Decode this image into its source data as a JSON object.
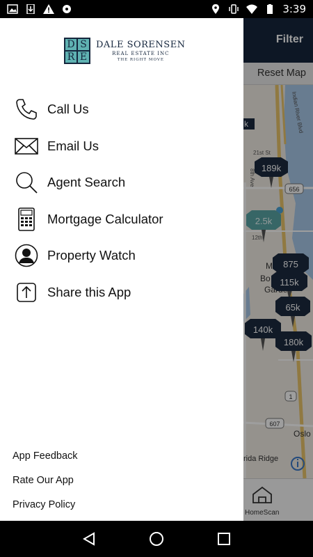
{
  "status_bar": {
    "time": "3:39",
    "left_icons": [
      "image-icon",
      "download-icon",
      "warning-icon",
      "location-sync-icon"
    ],
    "right_icons": [
      "location-icon",
      "vibrate-icon",
      "wifi-icon",
      "battery-icon"
    ]
  },
  "app": {
    "filter_label": "Filter",
    "reset_map_label": "Reset Map",
    "homescan_label": "HomeScan"
  },
  "map": {
    "street_labels": [
      "Indian River Blvd",
      "21st St",
      "8th Ave",
      "12th",
      "Ml",
      "Bo",
      "Garden",
      "Oslo",
      "rida Ridge"
    ],
    "route_shields": [
      "656",
      "1",
      "607"
    ],
    "price_markers": [
      {
        "label": "k"
      },
      {
        "label": "189k"
      },
      {
        "label": "2.5k"
      },
      {
        "label": "875"
      },
      {
        "label": "115k"
      },
      {
        "label": "65k"
      },
      {
        "label": "140k"
      },
      {
        "label": "180k"
      }
    ]
  },
  "drawer": {
    "logo": {
      "letters": [
        "D",
        "S",
        "R",
        "E"
      ],
      "name": "DALE SORENSEN",
      "sub": "REAL ESTATE INC",
      "tagline": "THE RIGHT MOVE"
    },
    "menu": [
      {
        "label": "Call Us",
        "icon": "phone-icon"
      },
      {
        "label": "Email Us",
        "icon": "envelope-icon"
      },
      {
        "label": "Agent Search",
        "icon": "search-icon"
      },
      {
        "label": "Mortgage Calculator",
        "icon": "calculator-icon"
      },
      {
        "label": "Property Watch",
        "icon": "person-icon"
      },
      {
        "label": "Share this App",
        "icon": "share-icon"
      }
    ],
    "footer": [
      {
        "label": "App Feedback"
      },
      {
        "label": "Rate Our App"
      },
      {
        "label": "Privacy Policy"
      }
    ]
  },
  "colors": {
    "header_navy": "#15263d",
    "logo_teal": "#5fb2b2",
    "marker_navy": "#1c2a3f",
    "marker_teal": "#5aa5a5"
  }
}
